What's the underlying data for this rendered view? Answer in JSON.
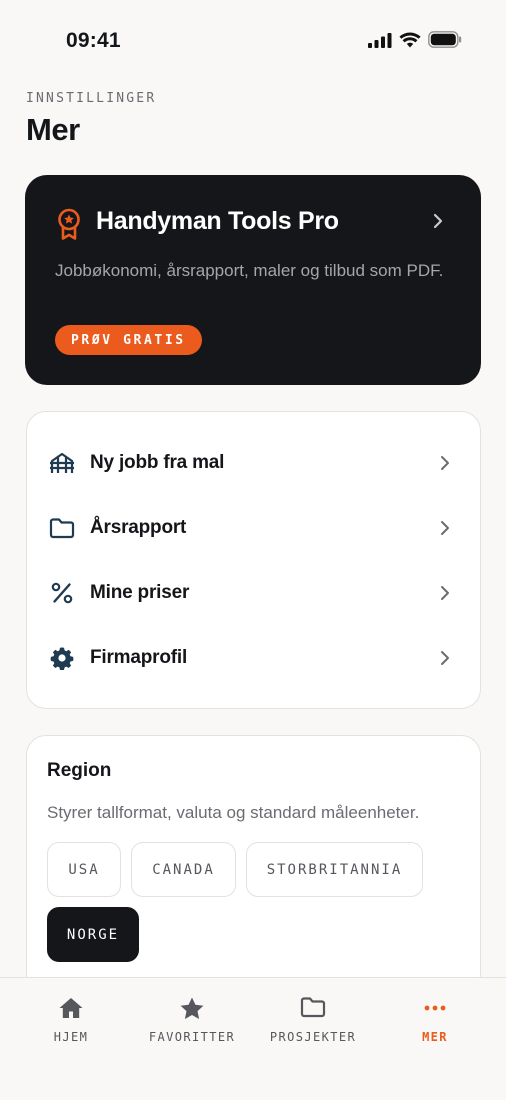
{
  "status_bar": {
    "time": "09:41"
  },
  "header": {
    "eyebrow": "INNSTILLINGER",
    "title": "Mer"
  },
  "pro_card": {
    "icon": "award-icon",
    "title": "Handyman Tools Pro",
    "description": "Jobbøkonomi, årsrapport, maler og tilbud som PDF.",
    "badge": "PRØV GRATIS"
  },
  "menu": {
    "items": [
      {
        "icon": "template-icon",
        "label": "Ny jobb fra mal"
      },
      {
        "icon": "folder-icon",
        "label": "Årsrapport"
      },
      {
        "icon": "percent-icon",
        "label": "Mine priser"
      },
      {
        "icon": "gear-icon",
        "label": "Firmaprofil"
      }
    ]
  },
  "region": {
    "title": "Region",
    "description": "Styrer tallformat, valuta og standard måleenheter.",
    "options": [
      "USA",
      "CANADA",
      "STORBRITANNIA",
      "NORGE"
    ],
    "selected": "NORGE"
  },
  "tabs": [
    {
      "icon": "home-icon",
      "label": "HJEM"
    },
    {
      "icon": "star-icon",
      "label": "FAVORITTER"
    },
    {
      "icon": "folder-icon",
      "label": "PROSJEKTER"
    },
    {
      "icon": "more-icon",
      "label": "MER"
    }
  ],
  "active_tab": "MER",
  "colors": {
    "accent": "#ea5b1d",
    "dark": "#151619",
    "background": "#f9f8f6"
  }
}
